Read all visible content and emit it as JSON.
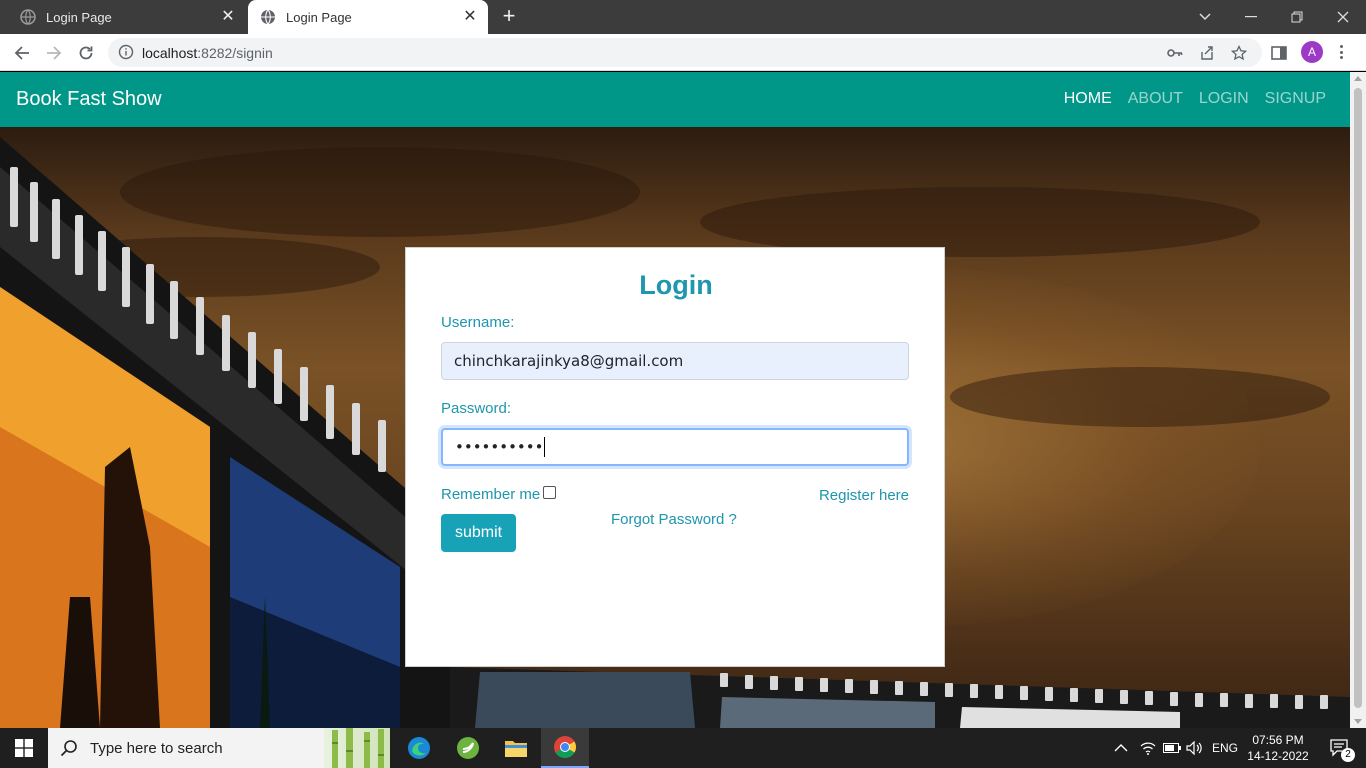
{
  "browser": {
    "tabs": [
      {
        "title": "Login Page",
        "active": false
      },
      {
        "title": "Login Page",
        "active": true
      }
    ],
    "url_host": "localhost",
    "url_path": ":8282/signin",
    "profile_initial": "A"
  },
  "navbar": {
    "brand": "Book Fast Show",
    "links": [
      "HOME",
      "ABOUT",
      "LOGIN",
      "SIGNUP"
    ],
    "active_link": "HOME"
  },
  "login": {
    "title": "Login",
    "username_label": "Username:",
    "username_value": "chinchkarajinkya8@gmail.com",
    "password_label": "Password:",
    "password_value": "••••••••••",
    "remember_label": "Remember me",
    "remember_checked": false,
    "register_link": "Register here",
    "forgot_link": "Forgot Password ?",
    "submit_label": "submit"
  },
  "taskbar": {
    "search_placeholder": "Type here to search",
    "language": "ENG",
    "time": "07:56 PM",
    "date": "14-12-2022",
    "notification_count": "2"
  },
  "colors": {
    "navbar": "#009688",
    "accent": "#1e96ad",
    "submit": "#17a2b8"
  }
}
